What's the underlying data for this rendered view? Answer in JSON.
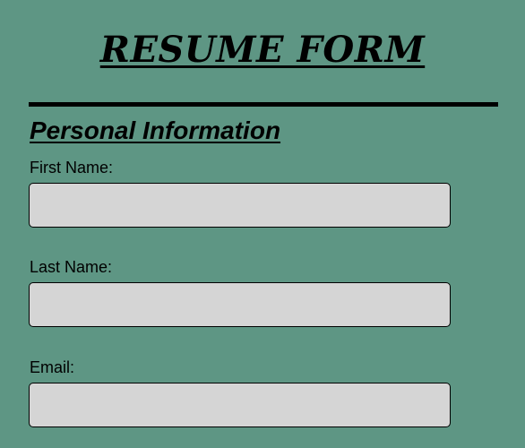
{
  "form": {
    "title": "RESUME FORM"
  },
  "personal_information": {
    "heading": "Personal Information",
    "fields": [
      {
        "label": "First Name:",
        "value": "",
        "placeholder": ""
      },
      {
        "label": "Last Name:",
        "value": "",
        "placeholder": ""
      },
      {
        "label": "Email:",
        "value": "",
        "placeholder": ""
      }
    ]
  },
  "colors": {
    "page_background": "#5e9684",
    "input_background": "#d5d5d5",
    "text": "#000000"
  }
}
